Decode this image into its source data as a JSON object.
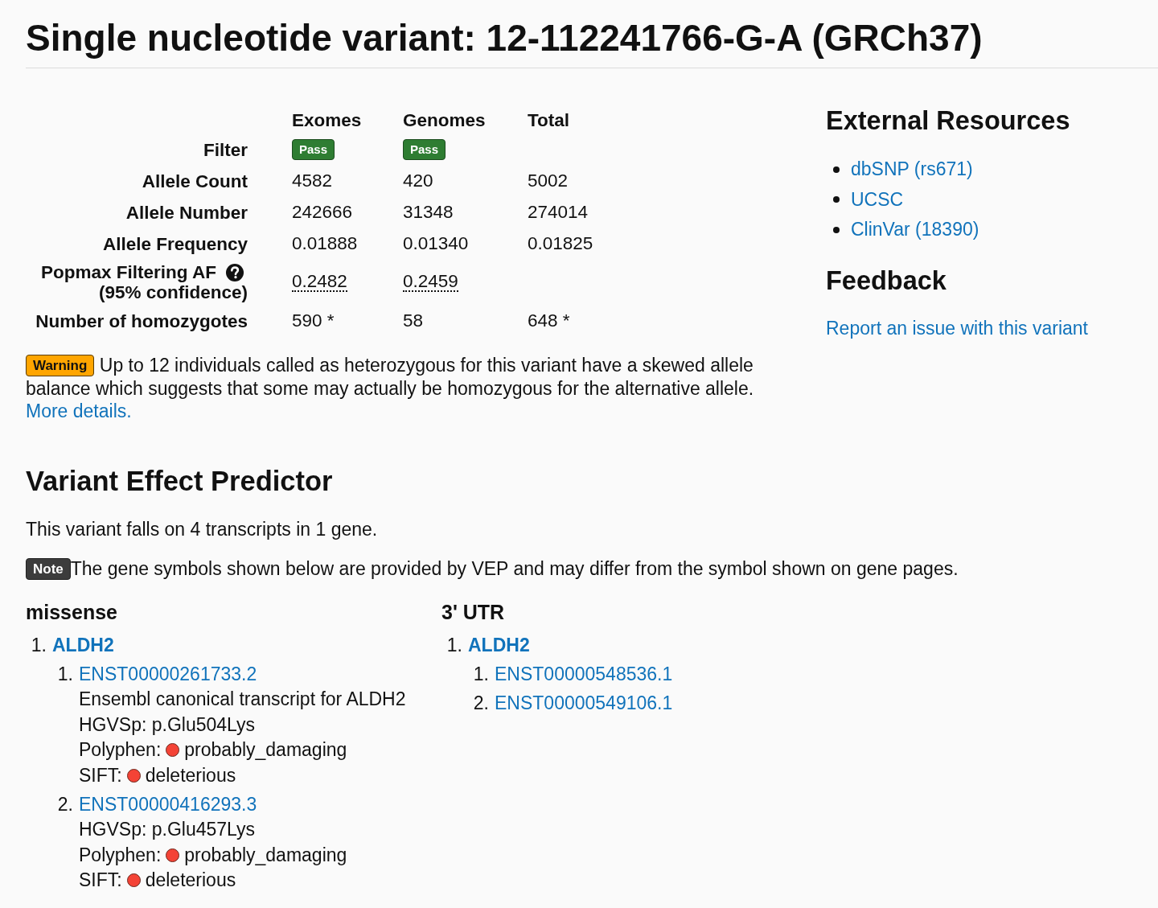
{
  "page_title": "Single nucleotide variant: 12-112241766-G-A (GRCh37)",
  "frequency_table": {
    "columns": [
      "Exomes",
      "Genomes",
      "Total"
    ],
    "rows": [
      {
        "label": "Filter",
        "kind": "badge",
        "cells": [
          "Pass",
          "Pass"
        ]
      },
      {
        "label": "Allele Count",
        "kind": "text",
        "cells": [
          "4582",
          "420",
          "5002"
        ]
      },
      {
        "label": "Allele Number",
        "kind": "text",
        "cells": [
          "242666",
          "31348",
          "274014"
        ]
      },
      {
        "label": "Allele Frequency",
        "kind": "text",
        "cells": [
          "0.01888",
          "0.01340",
          "0.01825"
        ]
      },
      {
        "label": "Popmax Filtering AF",
        "sublabel": "(95% confidence)",
        "kind": "abbr",
        "help_icon": true,
        "cells": [
          "0.2482",
          "0.2459"
        ]
      },
      {
        "label": "Number of homozygotes",
        "kind": "text",
        "cells": [
          "590 *",
          "58",
          "648 *"
        ]
      }
    ]
  },
  "warning": {
    "badge": "Warning",
    "text": "Up to 12 individuals called as heterozygous for this variant have a skewed allele balance which suggests that some may actually be homozygous for the alternative allele.",
    "link": "More details."
  },
  "external_resources": {
    "title": "External Resources",
    "links": [
      "dbSNP (rs671)",
      "UCSC",
      "ClinVar (18390)"
    ]
  },
  "feedback": {
    "title": "Feedback",
    "link": "Report an issue with this variant"
  },
  "vep": {
    "title": "Variant Effect Predictor",
    "summary": "This variant falls on 4 transcripts in 1 gene.",
    "note": {
      "badge": "Note",
      "text": "The gene symbols shown below are provided by VEP and may differ from the symbol shown on gene pages."
    },
    "consequences": [
      {
        "heading": "missense",
        "genes": [
          {
            "number": "1.",
            "symbol": "ALDH2",
            "transcripts": [
              {
                "number": "1.",
                "id": "ENST00000261733.2",
                "details": [
                  {
                    "kind": "text",
                    "text": "Ensembl canonical transcript for ALDH2"
                  },
                  {
                    "kind": "text",
                    "text": "HGVSp: p.Glu504Lys"
                  },
                  {
                    "kind": "prediction",
                    "label": "Polyphen:",
                    "value": "probably_damaging",
                    "color": "#f44336"
                  },
                  {
                    "kind": "prediction",
                    "label": "SIFT:",
                    "value": "deleterious",
                    "color": "#f44336"
                  }
                ]
              },
              {
                "number": "2.",
                "id": "ENST00000416293.3",
                "details": [
                  {
                    "kind": "text",
                    "text": "HGVSp: p.Glu457Lys"
                  },
                  {
                    "kind": "prediction",
                    "label": "Polyphen:",
                    "value": "probably_damaging",
                    "color": "#f44336"
                  },
                  {
                    "kind": "prediction",
                    "label": "SIFT:",
                    "value": "deleterious",
                    "color": "#f44336"
                  }
                ]
              }
            ]
          }
        ]
      },
      {
        "heading": "3' UTR",
        "genes": [
          {
            "number": "1.",
            "symbol": "ALDH2",
            "transcripts": [
              {
                "number": "1.",
                "id": "ENST00000548536.1"
              },
              {
                "number": "2.",
                "id": "ENST00000549106.1"
              }
            ]
          }
        ]
      }
    ]
  }
}
